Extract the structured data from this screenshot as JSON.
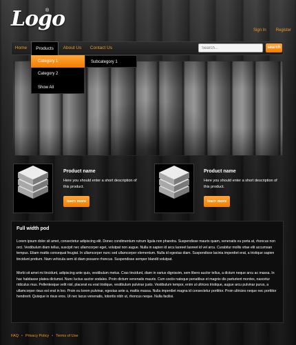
{
  "header": {
    "logo": "Logo",
    "logo_mark": "®",
    "links": [
      "Sign In",
      "Register"
    ]
  },
  "nav": {
    "items": [
      "Home",
      "Products",
      "About Us",
      "Contact Us"
    ],
    "active": "Products",
    "search_placeholder": "Search...",
    "search_button": "search"
  },
  "dropdown": {
    "items": [
      "Category 1",
      "Category 2",
      "Show All"
    ],
    "highlighted": "Category 1",
    "submenu": [
      "Subcategory 1"
    ]
  },
  "products": [
    {
      "title": "Product name",
      "description": "Here you should enter a short description of this product.",
      "button": "learn more",
      "icon": "stack-icon"
    },
    {
      "title": "Product name",
      "description": "Here you should enter a short description of this product.",
      "button": "learn more",
      "icon": "stack-icon"
    }
  ],
  "pod": {
    "title": "Full width pod",
    "paragraphs": [
      "Lorem ipsum dolor sit amet, consectetur adipiscing elit. Donec condimentum rutrum ligula non pharetra. Suspendisse mauris quam, venenatis eu porta at, rhoncus non orci. Vestibulum diam tellus, suscipit nec ullamcorper eget, volutpat non augue. Nulla in sapien id arcu laoreet laoreet id vel arcu. Curabitur mollis vitae elit accumsan tempus. Etiam mattis consequat feugiat. In ullamcorper nunc sed ullamcorper elementum. Nulla id egestas diam. Suspendisse lacinia imperdiet erat, a tristique sapien tincidunt pretium. Nam vehicula sem id diam posuere rhoncus. Suspendisse semper blandit volutpat.",
      "Morbi sit amet mi tincidunt, adipiscing ante quis, vestibulum metus. Cras tincidunt, diam in varius dignissim, sem libero auctor tellus, a dictum neque arcu ac massa. In hac habitasse platea dictumst. Nunc luctus auctor sodales. Proin dictum venenatis mauris. Cum sociis natoque penatibus et magnis dis parturient montes, nascetur ridiculus mus. Pellentesque velit nisl, placerat eu erat tristique, vestibulum pulvinar justo. Vestibulum tempor, enim ut ultrices tristique, augue arcu pulvinar purus, a ullamcorper risus est erat in leo. Proin eu lorem pulvinar, egestas ante a, mattis massa. Nulla imperdiet magna id consectetur porttitor. Proin ultricies neque nec porttitor hendrerit. Quisque in risus eros. Ut nec lacus venenatis, lobortis nibh ut, rhoncus neque. Nulla facilisi."
    ]
  },
  "footer": {
    "links": [
      "FAQ",
      "Privacy Policy",
      "Terms of Use"
    ],
    "separator": "•"
  },
  "colors": {
    "accent": "#f39a1e",
    "button": "#f07e00",
    "background": "#1c1c1c"
  }
}
